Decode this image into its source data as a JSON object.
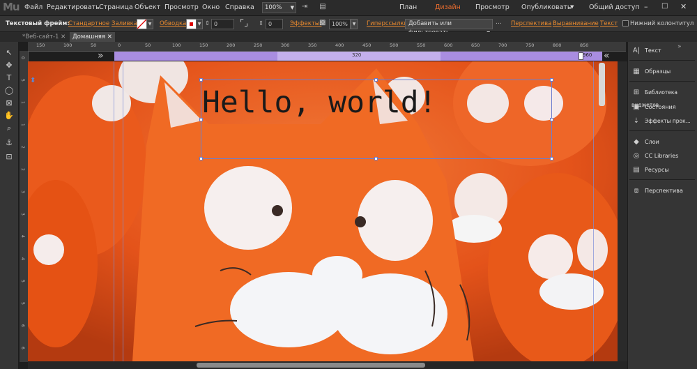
{
  "app": {
    "logo": "Mu",
    "menu": [
      "Файл",
      "Редактировать",
      "Страница",
      "Объект",
      "Просмотр",
      "Окно",
      "Справка"
    ],
    "zoom": "100%",
    "modes": [
      "План",
      "Дизайн",
      "Просмотр"
    ],
    "active_mode": "Дизайн",
    "publish": "Опубликовать",
    "shared_access": "Общий доступ"
  },
  "control_bar": {
    "frame_label": "Текстовый фрейм:",
    "style_value": "Стандартное",
    "fill_label": "Заливка:",
    "stroke_label": "Обводка:",
    "stroke_value": "0",
    "corner_value": "0",
    "effects_label": "Эффекты:",
    "opacity_value": "100%",
    "hyperlinks_label": "Гиперссылки:",
    "hyperlinks_dropdown": "Добавить или фильтровать",
    "perspective_link": "Перспектива",
    "align_link": "Выравнивание",
    "text_link": "Текст",
    "footer_label": "Нижний колонтитул"
  },
  "tabs": [
    {
      "label": "*Веб-сайт-1"
    },
    {
      "label": "Домашняя"
    }
  ],
  "ruler": {
    "h_ticks": [
      "150",
      "100",
      "50",
      "0",
      "50",
      "100",
      "150",
      "200",
      "250",
      "300",
      "350",
      "400",
      "450",
      "500",
      "550",
      "600",
      "650",
      "700",
      "750",
      "800",
      "850"
    ],
    "v_ticks": [
      "0",
      "5",
      "1",
      "1",
      "2",
      "2",
      "3",
      "3",
      "4",
      "4",
      "5",
      "5",
      "6",
      "6"
    ]
  },
  "breakpoints": {
    "mid": "320",
    "max": "960"
  },
  "canvas": {
    "text": "Hello, world!"
  },
  "panels": [
    {
      "label": "Текст",
      "icon": "text-panel-icon",
      "glyph": "A|"
    },
    {
      "label": "Образцы",
      "icon": "swatches-icon",
      "glyph": "▦"
    },
    {
      "label": "Библиотека виджетов",
      "icon": "widgets-library-icon",
      "glyph": "⊞"
    },
    {
      "label": "Состояния",
      "icon": "states-icon",
      "glyph": "▣"
    },
    {
      "label": "Эффекты прок...",
      "icon": "scroll-effects-icon",
      "glyph": "⇣"
    },
    {
      "label": "Слои",
      "icon": "layers-icon",
      "glyph": "◆"
    },
    {
      "label": "CC Libraries",
      "icon": "cc-libraries-icon",
      "glyph": "◎"
    },
    {
      "label": "Ресурсы",
      "icon": "assets-icon",
      "glyph": "▤"
    },
    {
      "label": "Перспектива",
      "icon": "perspective-icon",
      "glyph": "⧈"
    }
  ],
  "tools": [
    {
      "icon": "selection-arrow-icon",
      "glyph": "↖"
    },
    {
      "icon": "crop-tool-icon",
      "glyph": "✥"
    },
    {
      "icon": "text-tool-icon",
      "glyph": "T"
    },
    {
      "icon": "ellipse-tool-icon",
      "glyph": "◯"
    },
    {
      "icon": "rectangle-frame-tool-icon",
      "glyph": "⊠"
    },
    {
      "icon": "hand-tool-icon",
      "glyph": "✋"
    },
    {
      "icon": "zoom-tool-icon",
      "glyph": "⌕"
    },
    {
      "icon": "anchor-tool-icon",
      "glyph": "⚓"
    },
    {
      "icon": "frame-tool-icon",
      "glyph": "⊡"
    }
  ]
}
